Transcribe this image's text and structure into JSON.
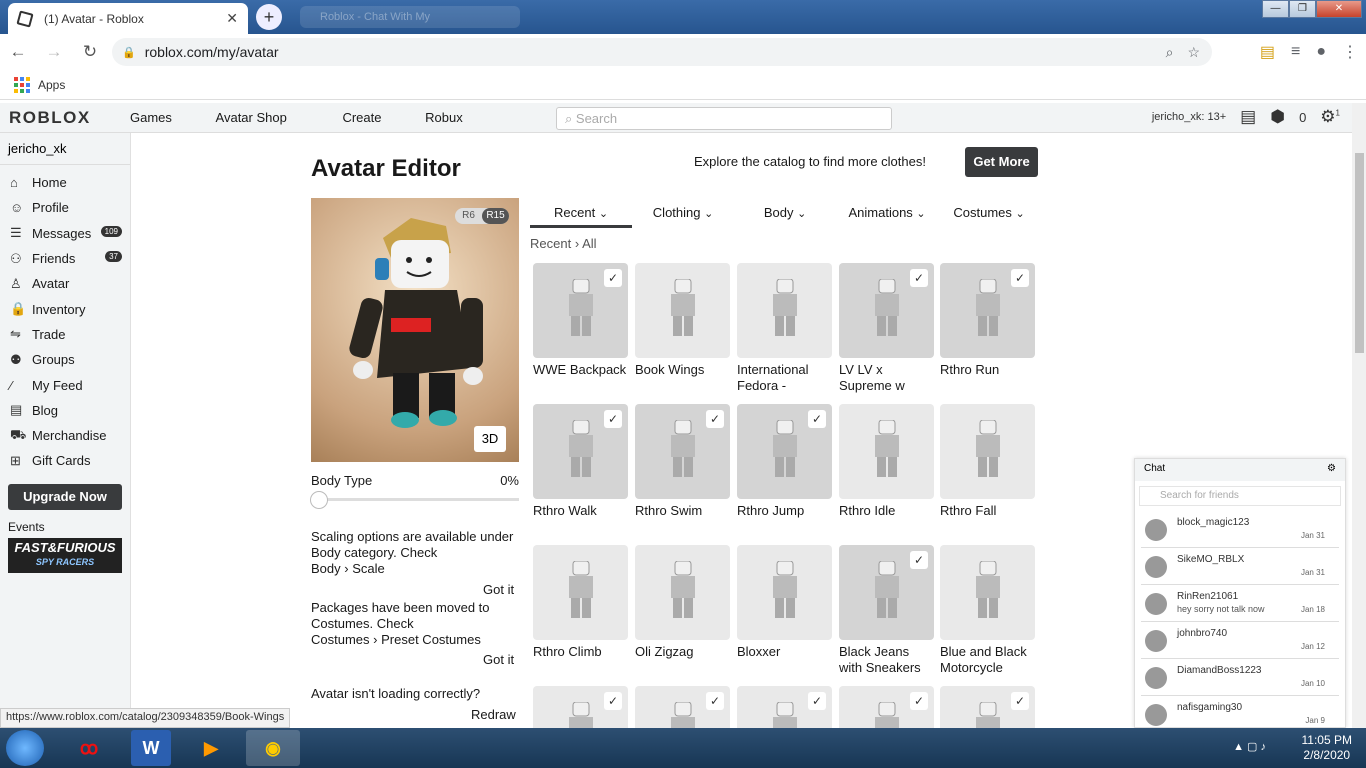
{
  "browser": {
    "tab_title": "(1) Avatar - Roblox",
    "new_tab": "+",
    "ghost_tab": "Roblox - Chat With My",
    "url": "roblox.com/my/avatar",
    "bookmark_apps": "Apps",
    "status_url": "https://www.roblox.com/catalog/2309348359/Book-Wings"
  },
  "header": {
    "logo": "ROBLOX",
    "nav": [
      "Games",
      "Avatar Shop",
      "Create",
      "Robux"
    ],
    "search_placeholder": "Search",
    "user_age": "jericho_xk: 13+",
    "robux": "0",
    "settings_badge": "1"
  },
  "sidebar": {
    "username": "jericho_xk",
    "items": [
      {
        "label": "Home",
        "icon": "home-icon"
      },
      {
        "label": "Profile",
        "icon": "profile-icon"
      },
      {
        "label": "Messages",
        "icon": "messages-icon",
        "badge": "109"
      },
      {
        "label": "Friends",
        "icon": "friends-icon",
        "badge": "37"
      },
      {
        "label": "Avatar",
        "icon": "avatar-icon"
      },
      {
        "label": "Inventory",
        "icon": "inventory-icon"
      },
      {
        "label": "Trade",
        "icon": "trade-icon"
      },
      {
        "label": "Groups",
        "icon": "groups-icon"
      },
      {
        "label": "My Feed",
        "icon": "feed-icon"
      },
      {
        "label": "Blog",
        "icon": "blog-icon"
      },
      {
        "label": "Merchandise",
        "icon": "cart-icon"
      },
      {
        "label": "Gift Cards",
        "icon": "gift-icon"
      }
    ],
    "upgrade": "Upgrade Now",
    "events": "Events",
    "event_banner": "FAST&FURIOUS",
    "event_sub": "SPY RACERS"
  },
  "editor": {
    "title": "Avatar Editor",
    "explore": "Explore the catalog to find more clothes!",
    "get_more": "Get More",
    "r6": "R6",
    "r15": "R15",
    "btn_3d": "3D",
    "body_type": "Body Type",
    "body_pct": "0%",
    "body_type_value": 0,
    "note1": "Scaling options are available under Body category. Check",
    "note1_b1": "Body",
    "note1_b2": "Scale",
    "got_it": "Got it",
    "note2": "Packages have been moved to Costumes. Check",
    "note2_b1": "Costumes",
    "note2_b2": "Preset Costumes",
    "loading": "Avatar isn't loading correctly?",
    "redraw": "Redraw",
    "crumb_sep": "›"
  },
  "tabs": [
    "Recent",
    "Clothing",
    "Body",
    "Animations",
    "Costumes"
  ],
  "breadcrumb": {
    "a": "Recent",
    "b": "All"
  },
  "items": [
    {
      "name": "WWE Backpack",
      "checked": true,
      "light": false
    },
    {
      "name": "Book Wings",
      "checked": false,
      "light": true
    },
    {
      "name": "International Fedora -",
      "checked": false,
      "light": true
    },
    {
      "name": "LV LV x Supreme w",
      "checked": true,
      "light": false
    },
    {
      "name": "Rthro Run",
      "checked": true,
      "light": false
    },
    {
      "name": "Rthro Walk",
      "checked": true,
      "light": false
    },
    {
      "name": "Rthro Swim",
      "checked": true,
      "light": false
    },
    {
      "name": "Rthro Jump",
      "checked": true,
      "light": false
    },
    {
      "name": "Rthro Idle",
      "checked": false,
      "light": true
    },
    {
      "name": "Rthro Fall",
      "checked": false,
      "light": true
    },
    {
      "name": "Rthro Climb",
      "checked": false,
      "light": true
    },
    {
      "name": "Oli Zigzag",
      "checked": false,
      "light": true
    },
    {
      "name": "Bloxxer",
      "checked": false,
      "light": true
    },
    {
      "name": "Black Jeans with Sneakers",
      "checked": true,
      "light": false
    },
    {
      "name": "Blue and Black Motorcycle",
      "checked": false,
      "light": true
    },
    {
      "name": "",
      "checked": true,
      "light": true
    },
    {
      "name": "",
      "checked": true,
      "light": true
    },
    {
      "name": "",
      "checked": true,
      "light": true
    },
    {
      "name": "",
      "checked": true,
      "light": true
    },
    {
      "name": "",
      "checked": true,
      "light": true
    }
  ],
  "chat": {
    "title": "Chat",
    "search": "Search for friends",
    "rows": [
      {
        "name": "block_magic123",
        "msg": "",
        "date": "Jan 31"
      },
      {
        "name": "SikeMO_RBLX",
        "msg": "",
        "date": "Jan 31"
      },
      {
        "name": "RinRen21061",
        "msg": "hey sorry not talk now",
        "date": "Jan 18"
      },
      {
        "name": "johnbro740",
        "msg": "",
        "date": "Jan 12"
      },
      {
        "name": "DiamandBoss1223",
        "msg": "",
        "date": "Jan 10"
      },
      {
        "name": "nafisgaming30",
        "msg": "",
        "date": "Jan 9"
      }
    ]
  },
  "taskbar": {
    "time": "11:05 PM",
    "date": "2/8/2020",
    "apps": [
      "garena-icon",
      "word-icon",
      "media-player-icon",
      "chrome-icon"
    ]
  }
}
